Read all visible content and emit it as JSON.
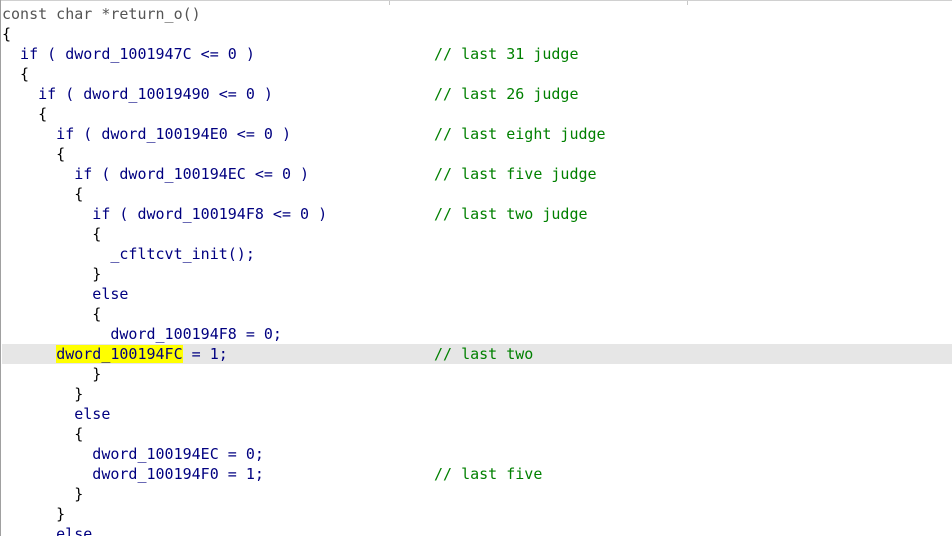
{
  "editor": {
    "signature": "const char *return_o()",
    "highlighted_token": "dword_100194FC",
    "highlighted_line_rest": " = 1;",
    "highlighted_line_indent": "      "
  },
  "code_lines": [
    {
      "text": "{",
      "comment": ""
    },
    {
      "text": "  if ( dword_1001947C <= 0 )",
      "comment": "// last 31 judge"
    },
    {
      "text": "  {",
      "comment": ""
    },
    {
      "text": "    if ( dword_10019490 <= 0 )",
      "comment": "// last 26 judge"
    },
    {
      "text": "    {",
      "comment": ""
    },
    {
      "text": "      if ( dword_100194E0 <= 0 )",
      "comment": "// last eight judge"
    },
    {
      "text": "      {",
      "comment": ""
    },
    {
      "text": "        if ( dword_100194EC <= 0 )",
      "comment": "// last five judge"
    },
    {
      "text": "        {",
      "comment": ""
    },
    {
      "text": "          if ( dword_100194F8 <= 0 )",
      "comment": "// last two judge"
    },
    {
      "text": "          {",
      "comment": ""
    },
    {
      "text": "            _cfltcvt_init();",
      "comment": ""
    },
    {
      "text": "          }",
      "comment": ""
    },
    {
      "text": "          else",
      "comment": ""
    },
    {
      "text": "          {",
      "comment": ""
    },
    {
      "text": "            dword_100194F8 = 0;",
      "comment": ""
    }
  ],
  "current_line": {
    "comment": "// last two"
  },
  "code_lines_after": [
    {
      "text": "          }",
      "comment": ""
    },
    {
      "text": "        }",
      "comment": ""
    },
    {
      "text": "        else",
      "comment": ""
    },
    {
      "text": "        {",
      "comment": ""
    },
    {
      "text": "          dword_100194EC = 0;",
      "comment": ""
    },
    {
      "text": "          dword_100194F0 = 1;",
      "comment": "// last five"
    },
    {
      "text": "        }",
      "comment": ""
    },
    {
      "text": "      }",
      "comment": ""
    },
    {
      "text": "      else",
      "comment": ""
    }
  ],
  "colors": {
    "code": "#000080",
    "comment": "#008000",
    "highlight": "#ffff00",
    "current_line": "#e6e6e6"
  }
}
